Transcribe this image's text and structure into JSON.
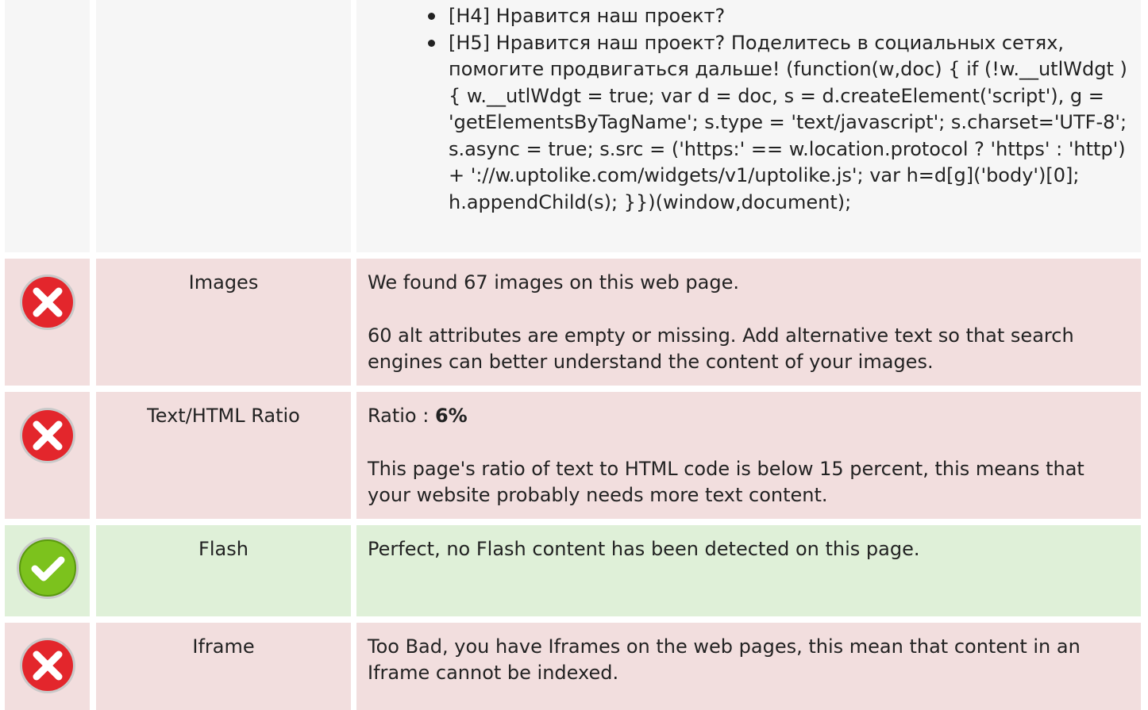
{
  "top_section": {
    "bullets": [
      "[H4] Нравится наш проект?",
      "[H5] Нравится наш проект? Поделитесь в социальных сетях, помогите продвигаться дальше! (function(w,doc) { if (!w.__utlWdgt ) { w.__utlWdgt = true; var d = doc, s = d.createElement('script'), g = 'getElementsByTagName'; s.type = 'text/javascript'; s.charset='UTF-8'; s.async = true; s.src = ('https:' == w.location.protocol ? 'https' : 'http') + '://w.uptolike.com/widgets/v1/uptolike.js'; var h=d[g]('body')[0]; h.appendChild(s); }})(window,document);"
    ]
  },
  "rows": [
    {
      "status": "error",
      "icon": "error-x-icon",
      "name": "Images",
      "text1": "We found 67 images on this web page.",
      "text2": "60 alt attributes are empty or missing. Add alternative text so that search engines can better understand the content of your images."
    },
    {
      "status": "error",
      "icon": "error-x-icon",
      "name": "Text/HTML Ratio",
      "ratio_label": "Ratio : ",
      "ratio_value": "6%",
      "text2": "This page's ratio of text to HTML code is below 15 percent, this means that your website probably needs more text content."
    },
    {
      "status": "success",
      "icon": "success-check-icon",
      "name": "Flash",
      "text1": "Perfect, no Flash content has been detected on this page."
    },
    {
      "status": "error",
      "icon": "error-x-icon",
      "name": "Iframe",
      "text1": "Too Bad, you have Iframes on the web pages, this mean that content in an Iframe cannot be indexed."
    }
  ],
  "colors": {
    "error_bg": "#f2dede",
    "success_bg": "#dff0d8",
    "neutral_bg": "#f6f6f6",
    "error_icon": "#e3262c",
    "success_icon": "#7cc21d"
  }
}
